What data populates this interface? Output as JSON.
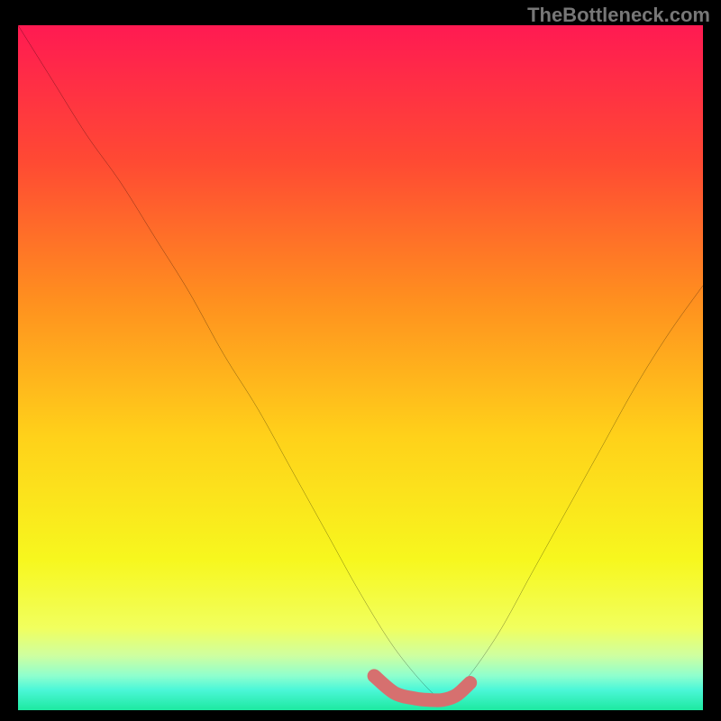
{
  "watermark": "TheBottleneck.com",
  "chart_data": {
    "type": "line",
    "title": "",
    "xlabel": "",
    "ylabel": "",
    "xlim": [
      0,
      100
    ],
    "ylim": [
      0,
      100
    ],
    "grid": false,
    "legend": false,
    "series": [
      {
        "name": "curve",
        "color": "#000000",
        "x": [
          0,
          5,
          10,
          15,
          20,
          25,
          30,
          35,
          40,
          45,
          50,
          55,
          60,
          62,
          65,
          70,
          75,
          80,
          85,
          90,
          95,
          100
        ],
        "y": [
          100,
          92,
          84,
          77,
          69,
          61,
          52,
          44,
          35,
          26,
          17,
          9,
          3,
          2,
          4,
          11,
          20,
          29,
          38,
          47,
          55,
          62
        ]
      },
      {
        "name": "highlight",
        "color": "#d6706f",
        "x": [
          52,
          55,
          58,
          60,
          62,
          64,
          66
        ],
        "y": [
          5,
          2.5,
          1.7,
          1.5,
          1.5,
          2.2,
          4
        ]
      }
    ],
    "gradient_stops": [
      {
        "offset": 0.0,
        "color": "#ff1a52"
      },
      {
        "offset": 0.2,
        "color": "#ff4a33"
      },
      {
        "offset": 0.4,
        "color": "#ff8f1f"
      },
      {
        "offset": 0.6,
        "color": "#ffd11a"
      },
      {
        "offset": 0.78,
        "color": "#f7f71e"
      },
      {
        "offset": 0.88,
        "color": "#f1ff5e"
      },
      {
        "offset": 0.92,
        "color": "#cfffa0"
      },
      {
        "offset": 0.95,
        "color": "#8effce"
      },
      {
        "offset": 0.97,
        "color": "#4cf7d8"
      },
      {
        "offset": 1.0,
        "color": "#1de9a0"
      }
    ]
  }
}
